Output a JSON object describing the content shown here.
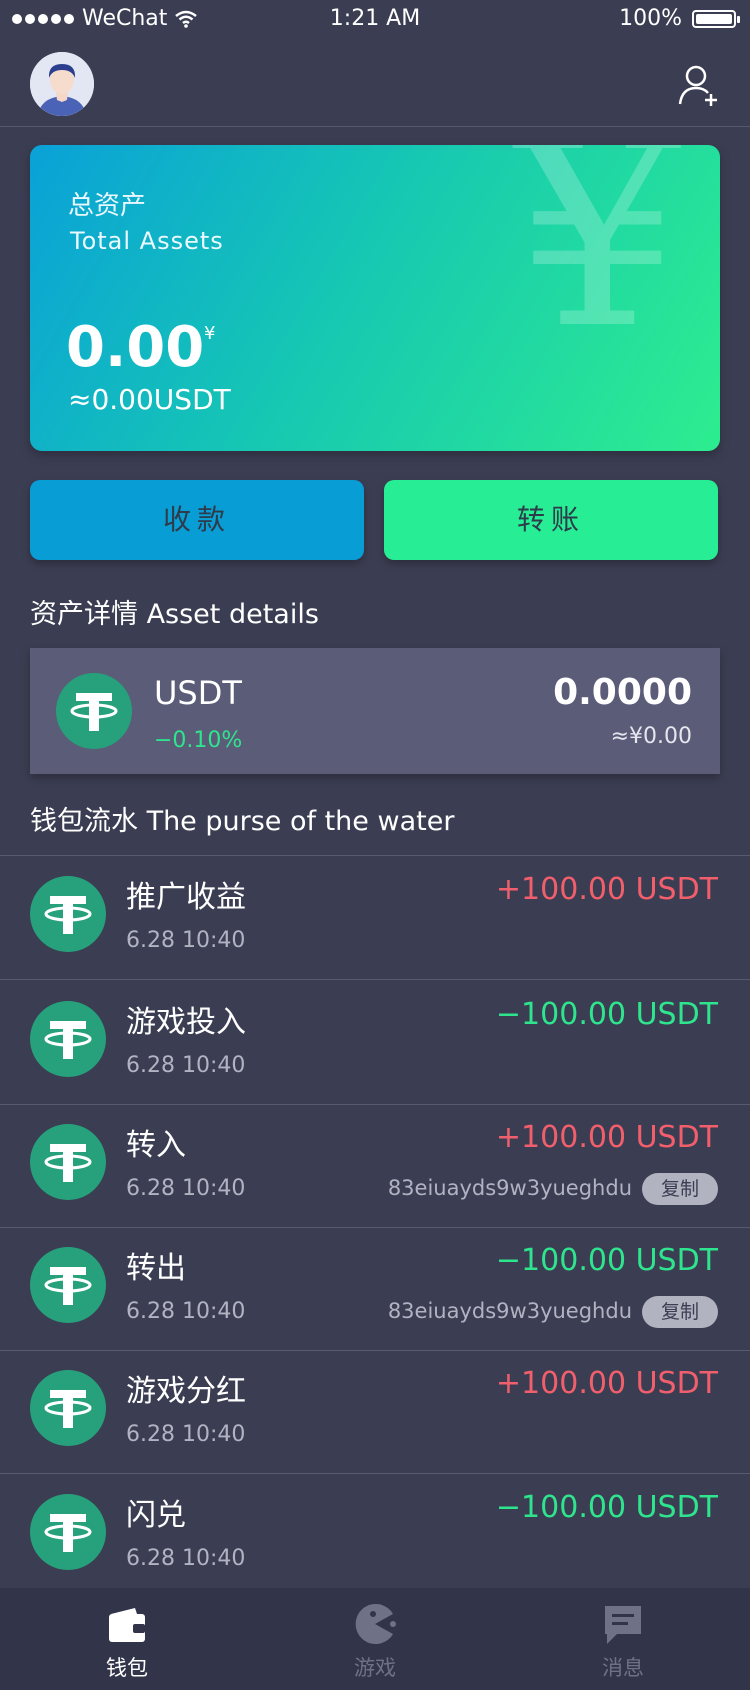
{
  "status_bar": {
    "carrier": "WeChat",
    "time": "1:21 AM",
    "battery": "100%"
  },
  "header": {
    "avatar_icon": "avatar-icon",
    "add_user_icon": "add-user-icon"
  },
  "card": {
    "title_cn": "总资产",
    "title_en": "Total Assets",
    "amount": "0.00",
    "currency_symbol": "¥",
    "usdt_equiv": "≈0.00USDT",
    "bg_symbol": "¥"
  },
  "buttons": {
    "receive": "收款",
    "transfer": "转账"
  },
  "asset_details": {
    "title": "资产详情 Asset details",
    "name": "USDT",
    "change": "−0.10%",
    "balance": "0.0000",
    "balance_cny": "≈¥0.00"
  },
  "wallet_flow": {
    "title": "钱包流水 The purse of the water",
    "transactions": [
      {
        "label": "推广收益",
        "time": "6.28  10:40",
        "amount": "+100.00 USDT"
      },
      {
        "label": "游戏投入",
        "time": "6.28  10:40",
        "amount": "−100.00 USDT"
      },
      {
        "label": "转入",
        "time": "6.28  10:40",
        "amount": "+100.00 USDT",
        "address": "83eiuayds9w3yueghdu",
        "copy": "复制"
      },
      {
        "label": "转出",
        "time": "6.28  10:40",
        "amount": "−100.00 USDT",
        "address": "83eiuayds9w3yueghdu",
        "copy": "复制"
      },
      {
        "label": "游戏分红",
        "time": "6.28  10:40",
        "amount": "+100.00 USDT"
      },
      {
        "label": "闪兑",
        "time": "6.28  10:40",
        "amount": "−100.00 USDT"
      }
    ]
  },
  "tab_bar": {
    "items": [
      {
        "label": "钱包",
        "icon": "wallet-icon",
        "active": true
      },
      {
        "label": "游戏",
        "icon": "game-icon",
        "active": false
      },
      {
        "label": "消息",
        "icon": "message-icon",
        "active": false
      }
    ]
  },
  "colors": {
    "background": "#3b3d52",
    "positive": "#f25f6c",
    "negative": "#2ee58e",
    "tether": "#26a17b",
    "tab_active": "#ffffff",
    "tab_inactive": "#6f7186"
  }
}
